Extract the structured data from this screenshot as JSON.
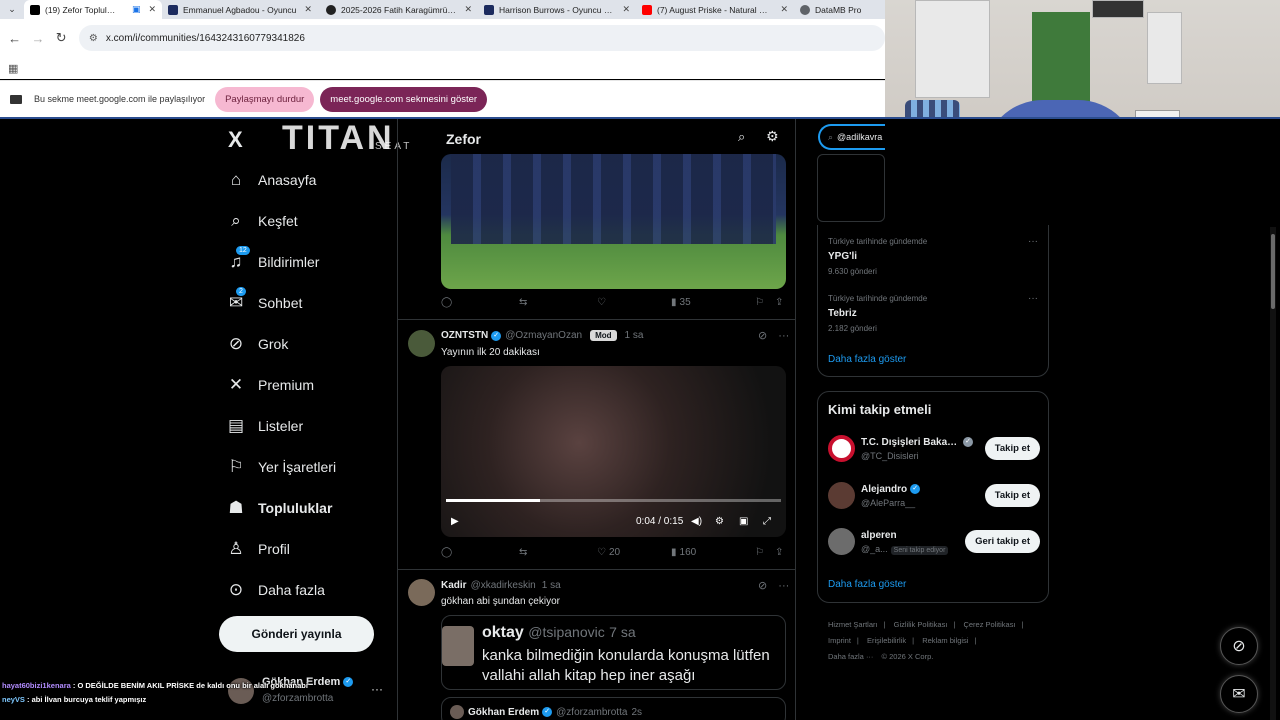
{
  "browser": {
    "tabs": [
      {
        "title": "(19) Zefor Topluluk / X",
        "color": "#000000",
        "active": true
      },
      {
        "title": "Emmanuel Agbadou - Oyuncu",
        "color": "#1c2b5e",
        "active": false
      },
      {
        "title": "2025-2026 Fatih Karagümrük S.K.",
        "color": "#222222",
        "active": false
      },
      {
        "title": "Harrison Burrows - Oyuncu pro",
        "color": "#1c2b5e",
        "active": false
      },
      {
        "title": "(7) August Priske - Natural Goal",
        "color": "#ff0000",
        "active": false
      },
      {
        "title": "DataMB Pro",
        "color": "#5f6368",
        "active": false
      }
    ],
    "url": "x.com/i/communities/1643243160779341826",
    "share_text": "Bu sekme meet.google.com ile paylaşılıyor",
    "stop_sharing": "Paylaşmayı durdur",
    "show_tab": "meet.google.com sekmesini göster"
  },
  "overlay": {
    "brand": "TITAN",
    "brand_sub": "SEAT"
  },
  "nav": {
    "logo": "X",
    "items": [
      {
        "label": "Anasayfa",
        "icon": "home-icon",
        "glyph": "⌂"
      },
      {
        "label": "Keşfet",
        "icon": "search-icon",
        "glyph": "⌕"
      },
      {
        "label": "Bildirimler",
        "icon": "bell-icon",
        "glyph": "🔔",
        "badge": "12"
      },
      {
        "label": "Sohbet",
        "icon": "mail-icon",
        "glyph": "✉",
        "badge": "2"
      },
      {
        "label": "Grok",
        "icon": "grok-icon",
        "glyph": "⊘"
      },
      {
        "label": "Premium",
        "icon": "x-premium-icon",
        "glyph": "𝕏"
      },
      {
        "label": "Listeler",
        "icon": "list-icon",
        "glyph": "▤"
      },
      {
        "label": "Yer İşaretleri",
        "icon": "bookmark-icon",
        "glyph": "⚑"
      },
      {
        "label": "Topluluklar",
        "icon": "communities-icon",
        "glyph": "👥"
      },
      {
        "label": "Profil",
        "icon": "profile-icon",
        "glyph": "👤"
      },
      {
        "label": "Daha fazla",
        "icon": "more-circle-icon",
        "glyph": "⋯"
      }
    ],
    "post_button": "Gönderi yayınla",
    "account": {
      "name": "Gökhan Erdem",
      "handle": "@zforzambrotta"
    }
  },
  "timeline": {
    "title": "Zefor",
    "post1_actions": {
      "views": "35"
    },
    "post2": {
      "name": "OZNTSTN",
      "handle": "@OzmayanOzan",
      "badge": "Mod",
      "time": "1 sa",
      "text": "Yayının ilk 20 dakikası",
      "video_time": "0:04 / 0:15",
      "video_progress": 0.28,
      "likes": "20",
      "views": "160"
    },
    "post3": {
      "name": "Kadir",
      "handle": "@xkadirkeskin",
      "time": "1 sa",
      "text": "gökhan abi şundan çekiyor",
      "quote": {
        "name": "oktay",
        "handle": "@tsipanovic",
        "time": "7 sa",
        "line1": "kanka bilmediğin konularda konuşma lütfen",
        "line2": "vallahi allah kitap hep iner aşağı"
      },
      "quote2": {
        "name": "Gökhan Erdem",
        "handle": "@zforzambrotta",
        "time": "2s"
      }
    }
  },
  "right": {
    "search_value": "@adilkavra",
    "trends": [
      {
        "category": "Türkiye tarihinde gündemde",
        "name": "YPG'li",
        "count": "9.630 gönderi"
      },
      {
        "category": "Türkiye tarihinde gündemde",
        "name": "Tebriz",
        "count": "2.182 gönderi"
      }
    ],
    "show_more": "Daha fazla göster",
    "who_to_follow": "Kimi takip etmeli",
    "suggestions": [
      {
        "name": "T.C. Dışişleri Bakan...",
        "handle": "@TC_Disisleri",
        "button": "Takip et",
        "avatar_color": "#c8102e",
        "verified": true
      },
      {
        "name": "Alejandro",
        "handle": "@AleParra__",
        "button": "Takip et",
        "avatar_color": "#5b3b33",
        "verified": true
      },
      {
        "name": "alperen",
        "handle": "@_a...",
        "follows_you": "Seni takip ediyor",
        "button": "Geri takip et",
        "avatar_color": "#6c6c6c",
        "verified": false
      }
    ],
    "show_more_2": "Daha fazla göster",
    "footer": [
      "Hizmet Şartları",
      "|",
      "Gizlilik Politikası",
      "|",
      "Çerez Politikası",
      "|",
      "Imprint",
      "|",
      "Erişilebilirlik",
      "|",
      "Reklam bilgisi",
      "|",
      "Daha fazla ···",
      "© 2026 X Corp."
    ]
  },
  "chat": {
    "line1_user": "hayat60bizi1kenara",
    "line1_text": ": O DEĞİLDE BENİM AKIL PRİSKE de kaldı onu bir alalı gökhanabi",
    "line2_user": "neyVS",
    "line2_text": ": abi İlvan burcuya teklif yapmışız"
  }
}
